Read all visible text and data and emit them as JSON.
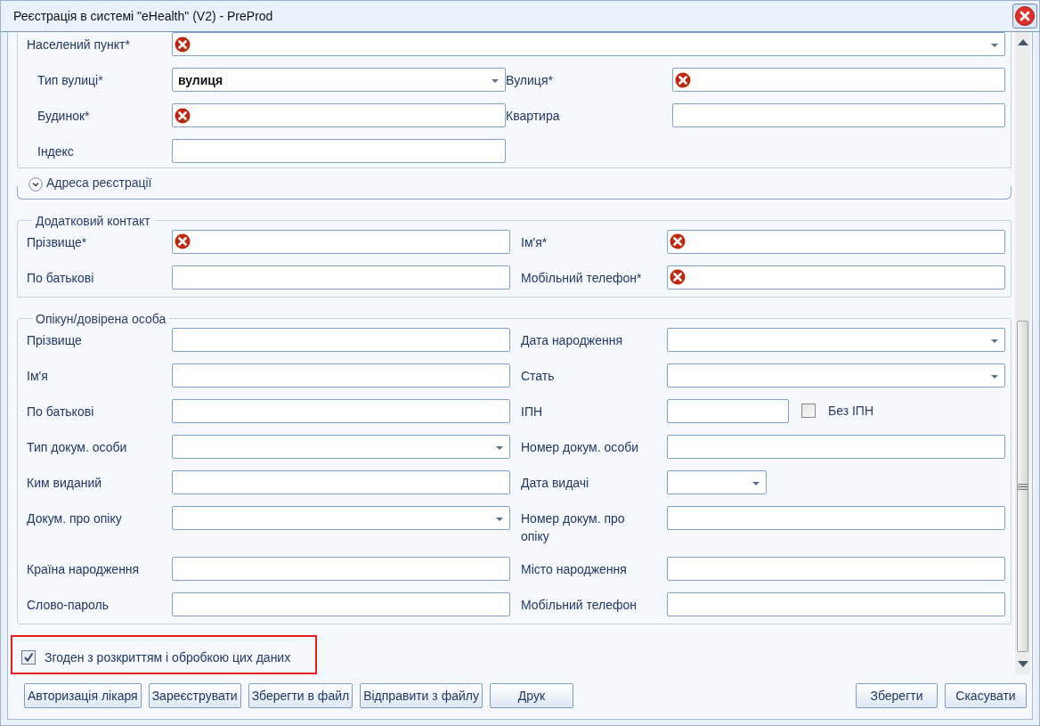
{
  "window": {
    "title": "Реєстрація в системі \"eHealth\" (V2) - PreProd"
  },
  "address": {
    "fields": [
      {
        "label": "Населений пункт*",
        "kind": "combo-full",
        "error": true
      },
      {
        "label": "Тип вулиці*",
        "kind": "combo",
        "error": false,
        "value": "вулиця"
      },
      {
        "label": "Вулиця*",
        "kind": "text",
        "error": true
      },
      {
        "label": "Будинок*",
        "kind": "text",
        "error": true
      },
      {
        "label": "Квартира",
        "kind": "text",
        "error": false
      },
      {
        "label": "Індекс",
        "kind": "text",
        "error": false
      }
    ]
  },
  "registration_address": {
    "title": "Адреса реєстрації",
    "expanded": false
  },
  "additional_contact": {
    "title": "Додатковий контакт",
    "fields": [
      {
        "label": "Прізвище*",
        "kind": "text",
        "error": true
      },
      {
        "label": "Ім'я*",
        "kind": "text",
        "error": true
      },
      {
        "label": "По батькові",
        "kind": "text",
        "error": false
      },
      {
        "label": "Мобільний телефон*",
        "kind": "text",
        "error": true
      }
    ]
  },
  "guardian": {
    "title": "Опікун/довірена особа",
    "fields": [
      {
        "label": "Прізвище",
        "kind": "text",
        "error": false
      },
      {
        "label": "Дата народження",
        "kind": "combo",
        "error": false
      },
      {
        "label": "Ім'я",
        "kind": "text",
        "error": false
      },
      {
        "label": "Стать",
        "kind": "combo",
        "error": false
      },
      {
        "label": "По батькові",
        "kind": "text",
        "error": false
      },
      {
        "label": "ІПН",
        "kind": "text-short",
        "error": false,
        "checkbox": {
          "label": "Без ІПН",
          "checked": false
        }
      },
      {
        "label": "Тип докум. особи",
        "kind": "combo",
        "error": false
      },
      {
        "label": "Номер докум. особи",
        "kind": "text",
        "error": false
      },
      {
        "label": "Ким виданий",
        "kind": "text",
        "error": false
      },
      {
        "label": "Дата видачі",
        "kind": "combo-short",
        "error": false
      },
      {
        "label": "Докум. про опіку",
        "kind": "combo",
        "error": false
      },
      {
        "label": "Номер докум. про опіку",
        "kind": "text",
        "error": false
      },
      {
        "label": "Країна народження",
        "kind": "text",
        "error": false
      },
      {
        "label": "Місто народження",
        "kind": "text",
        "error": false
      },
      {
        "label": "Слово-пароль",
        "kind": "text",
        "error": false
      },
      {
        "label": "Мобільний телефон",
        "kind": "text",
        "error": false
      }
    ]
  },
  "consent": {
    "label": "Згоден з розкриттям і обробкою цих даних",
    "checked": true,
    "highlighted": true
  },
  "buttons_left": [
    "Авторизація лікаря",
    "Зареєструвати",
    "Зберегти в файл",
    "Відправити з файлу",
    "Друк"
  ],
  "buttons_right": [
    "Зберегти",
    "Скасувати"
  ]
}
